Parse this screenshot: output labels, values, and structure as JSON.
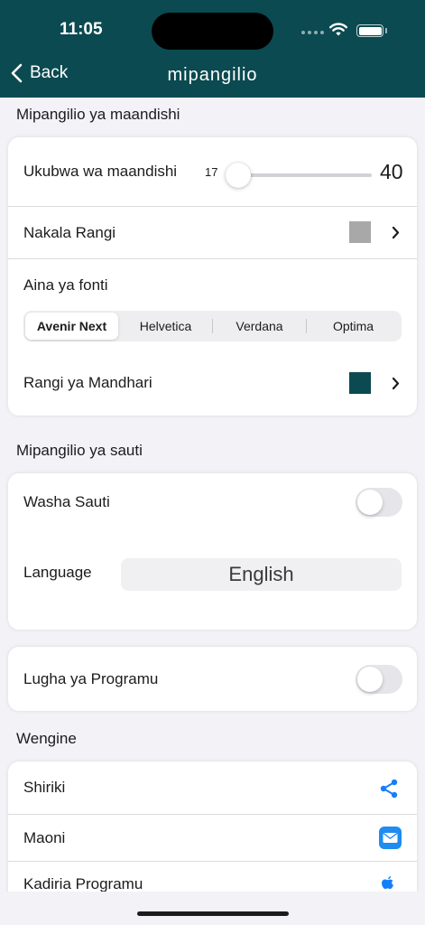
{
  "status_bar": {
    "time": "11:05"
  },
  "nav": {
    "back_label": "Back",
    "title": "mipangilio"
  },
  "text_settings": {
    "section_title": "Mipangilio ya maandishi",
    "font_size": {
      "label": "Ukubwa wa maandishi",
      "min": "17",
      "max": "40",
      "value": 17
    },
    "text_color": {
      "label": "Nakala Rangi",
      "color": "#a8a8a8"
    },
    "font_type": {
      "label": "Aina ya fonti",
      "options": [
        "Avenir Next",
        "Helvetica",
        "Verdana",
        "Optima"
      ],
      "selected": "Avenir Next"
    },
    "theme_color": {
      "label": "Rangi ya Mandhari",
      "color": "#0b4a50"
    }
  },
  "sound_settings": {
    "section_title": "Mipangilio ya sauti",
    "sound_toggle": {
      "label": "Washa Sauti",
      "on": false
    },
    "language": {
      "label": "Language",
      "value": "English"
    }
  },
  "app_language": {
    "label": "Lugha ya Programu",
    "on": false
  },
  "other": {
    "section_title": "Wengine",
    "items": [
      {
        "label": "Shiriki",
        "icon": "share-icon"
      },
      {
        "label": "Maoni",
        "icon": "mail-icon"
      },
      {
        "label": "Kadiria Programu",
        "icon": "apple-icon"
      }
    ]
  },
  "colors": {
    "accent": "#0b4a50",
    "background": "#f2f2f7",
    "link_blue": "#147efb"
  }
}
